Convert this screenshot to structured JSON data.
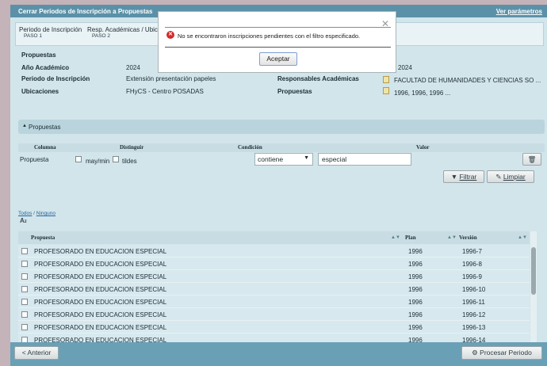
{
  "window": {
    "title": "Cerrar Periodos de Inscripción a Propuestas",
    "params_link": "Ver parámetros"
  },
  "steps": [
    {
      "label": "Periodo de Inscripción",
      "sub": "PASO 1"
    },
    {
      "label": "Resp. Académicas / Ubicac",
      "sub": "PASO 2"
    }
  ],
  "info": {
    "header": "Propuestas",
    "anio_label": "Año Académico",
    "anio_value": "2024",
    "anio_value_right": "2024",
    "periodo_label": "Periodo de Inscripción",
    "periodo_value": "Extensión presentación papeles",
    "resp_label": "Responsables Académicas",
    "resp_value": "FACULTAD DE HUMANIDADES Y CIENCIAS SO ...",
    "ubic_label": "Ubicaciones",
    "ubic_value": "FHyCS - Centro POSADAS",
    "prop_label": "Propuestas",
    "prop_value": "1996, 1996, 1996 ..."
  },
  "filter_panel": {
    "title": "Propuestas",
    "col_columna": "Columna",
    "col_distinguir": "Distinguir",
    "col_condicion": "Condición",
    "col_valor": "Valor",
    "row_label": "Propuesta",
    "opt_mayus": "may/min",
    "opt_tildes": "tildes",
    "condition": "contiene",
    "value": "especial",
    "btn_filtrar": "Filtrar",
    "btn_limpiar": "Limpiar"
  },
  "select_links": {
    "todos": "Todos",
    "ninguno": "Ninguno",
    "sep": "/"
  },
  "table": {
    "headers": [
      "Propuesta",
      "Plan",
      "Versión"
    ],
    "rows": [
      [
        "PROFESORADO EN EDUCACION ESPECIAL",
        "1996",
        "1996-7"
      ],
      [
        "PROFESORADO EN EDUCACION ESPECIAL",
        "1996",
        "1996-8"
      ],
      [
        "PROFESORADO EN EDUCACION ESPECIAL",
        "1996",
        "1996-9"
      ],
      [
        "PROFESORADO EN EDUCACION ESPECIAL",
        "1996",
        "1996-10"
      ],
      [
        "PROFESORADO EN EDUCACION ESPECIAL",
        "1996",
        "1996-11"
      ],
      [
        "PROFESORADO EN EDUCACION ESPECIAL",
        "1996",
        "1996-12"
      ],
      [
        "PROFESORADO EN EDUCACION ESPECIAL",
        "1996",
        "1996-13"
      ],
      [
        "PROFESORADO EN EDUCACION ESPECIAL",
        "1996",
        "1996-14"
      ]
    ]
  },
  "footer": {
    "back": "< Anterior",
    "process": "Procesar Periodo"
  },
  "dialog": {
    "message": "No se encontraron inscripciones pendientes con el filtro especificado.",
    "ok": "Aceptar"
  },
  "colors": {
    "header_bar": "#5a91a8",
    "panel_bg": "#d2e5ea",
    "error": "#d42a2a"
  }
}
